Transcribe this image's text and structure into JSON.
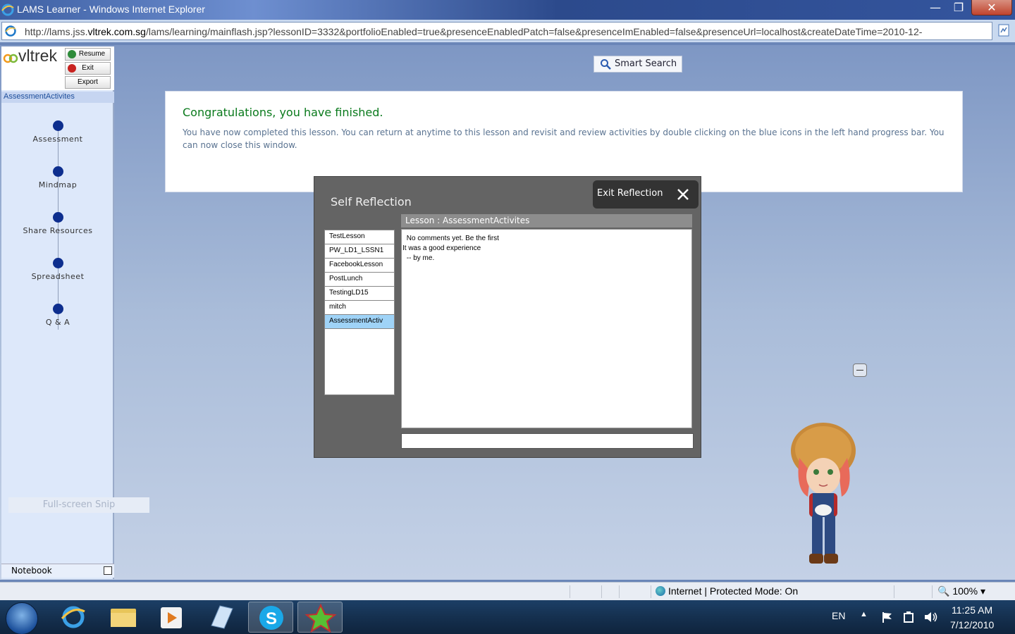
{
  "window": {
    "title": "LAMS Learner - Windows Internet Explorer",
    "minimize": "—",
    "maximize": "❐",
    "close": "✕"
  },
  "address": {
    "url_prefix": "http://lams.jss.",
    "url_domain": "vltrek.com.sg",
    "url_rest": "/lams/learning/mainflash.jsp?lessonID=3332&portfolioEnabled=true&presenceEnabledPatch=false&presenceImEnabled=false&presenceUrl=localhost&createDateTime=2010-12-"
  },
  "sidebar": {
    "logo": "vltrek",
    "buttons": {
      "resume": "Resume",
      "exit": "Exit",
      "export": "Export"
    },
    "lesson_name": "AssessmentActivites",
    "activities": [
      {
        "label": "Assessment"
      },
      {
        "label": "Mindmap"
      },
      {
        "label": "Share Resources"
      },
      {
        "label": "Spreadsheet"
      },
      {
        "label": "Q & A"
      }
    ],
    "snip_text": "Full-screen Snip",
    "notebook": "Notebook"
  },
  "search": {
    "label": "Smart Search"
  },
  "finished": {
    "heading": "Congratulations, you have finished.",
    "message": "You have now completed this lesson. You can return at anytime to this lesson and revisit and review activities by double clicking on the blue icons in the left hand progress bar. You can now close this window."
  },
  "reflection": {
    "title": "Self Reflection",
    "exit_label": "Exit  Reflection",
    "lessons": [
      "TestLesson",
      "PW_LD1_LSSN1",
      "FacebookLesson",
      "PostLunch",
      "TestingLD15",
      "mitch",
      "AssessmentActiv"
    ],
    "selected_index": 6,
    "header": "Lesson : AssessmentActivites",
    "comments": [
      " No comments yet. Be the first",
      "It was a good experience",
      " -- by me."
    ],
    "input_value": ""
  },
  "status": {
    "zone": "Internet | Protected Mode: On",
    "zoom": "100%"
  },
  "taskbar": {
    "lang": "EN",
    "time": "11:25 AM",
    "date": "7/12/2010"
  },
  "colors": {
    "accent": "#0d2e8e",
    "success": "#0a7a1c",
    "selection": "#9fd3f7"
  }
}
